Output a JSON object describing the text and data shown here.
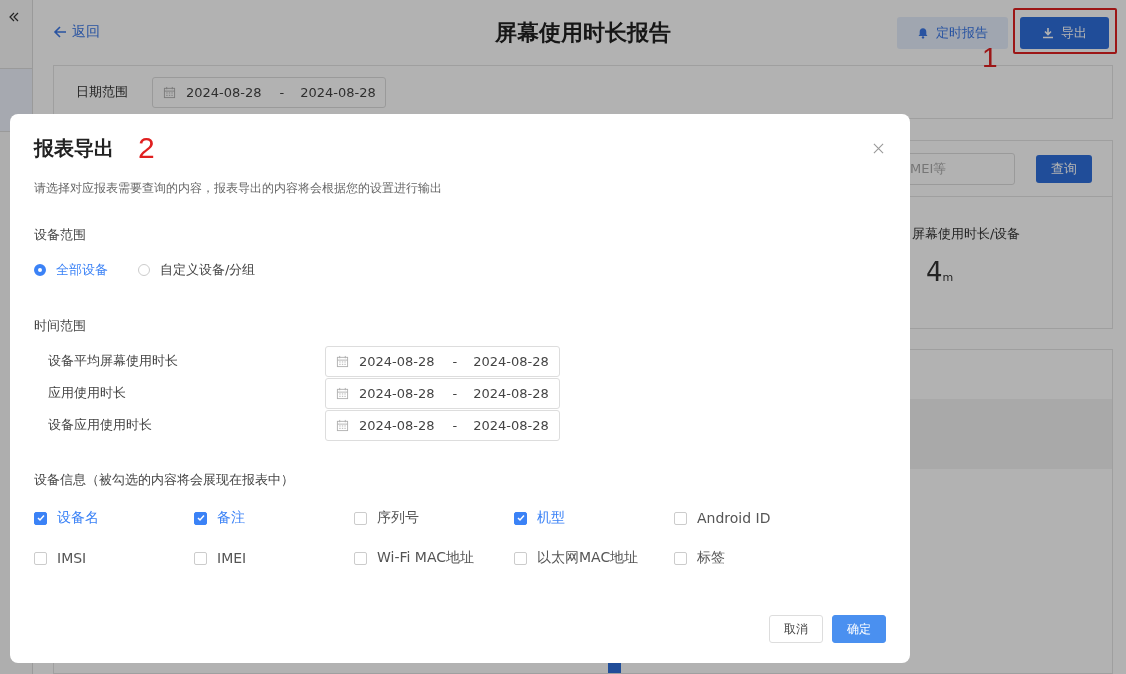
{
  "header": {
    "back": "返回",
    "title": "屏幕使用时长报告",
    "annotation": "1",
    "buttons": [
      {
        "label": "定时报告",
        "kind": "secondary",
        "highlighted": false
      },
      {
        "label": "导出",
        "kind": "primary",
        "highlighted": true
      }
    ]
  },
  "filter": {
    "label": "日期范围",
    "start": "2024-08-28",
    "separator": "-",
    "end": "2024-08-28"
  },
  "search": {
    "placeholder": "MEI等",
    "button": "查询"
  },
  "stat": {
    "label": "屏幕使用时长/设备",
    "value": "4",
    "unit": "m"
  },
  "modal": {
    "title": "报表导出",
    "annotation": "2",
    "description": "请选择对应报表需要查询的内容，报表导出的内容将会根据您的设置进行输出",
    "device_scope": {
      "label": "设备范围",
      "options": [
        {
          "label": "全部设备",
          "selected": true
        },
        {
          "label": "自定义设备/分组",
          "selected": false
        }
      ]
    },
    "time_range": {
      "label": "时间范围",
      "rows": [
        {
          "label": "设备平均屏幕使用时长",
          "start": "2024-08-28",
          "separator": "-",
          "end": "2024-08-28"
        },
        {
          "label": "应用使用时长",
          "start": "2024-08-28",
          "separator": "-",
          "end": "2024-08-28"
        },
        {
          "label": "设备应用使用时长",
          "start": "2024-08-28",
          "separator": "-",
          "end": "2024-08-28"
        }
      ]
    },
    "device_info": {
      "label": "设备信息（被勾选的内容将会展现在报表中）",
      "options": [
        {
          "label": "设备名",
          "checked": true
        },
        {
          "label": "备注",
          "checked": true
        },
        {
          "label": "序列号",
          "checked": false
        },
        {
          "label": "机型",
          "checked": true
        },
        {
          "label": "Android ID",
          "checked": false
        },
        {
          "label": "IMSI",
          "checked": false
        },
        {
          "label": "IMEI",
          "checked": false
        },
        {
          "label": "Wi-Fi MAC地址",
          "checked": false
        },
        {
          "label": "以太网MAC地址",
          "checked": false
        },
        {
          "label": "标签",
          "checked": false
        }
      ]
    },
    "buttons": [
      {
        "label": "取消",
        "kind": "default"
      },
      {
        "label": "确定",
        "kind": "primary"
      }
    ]
  }
}
